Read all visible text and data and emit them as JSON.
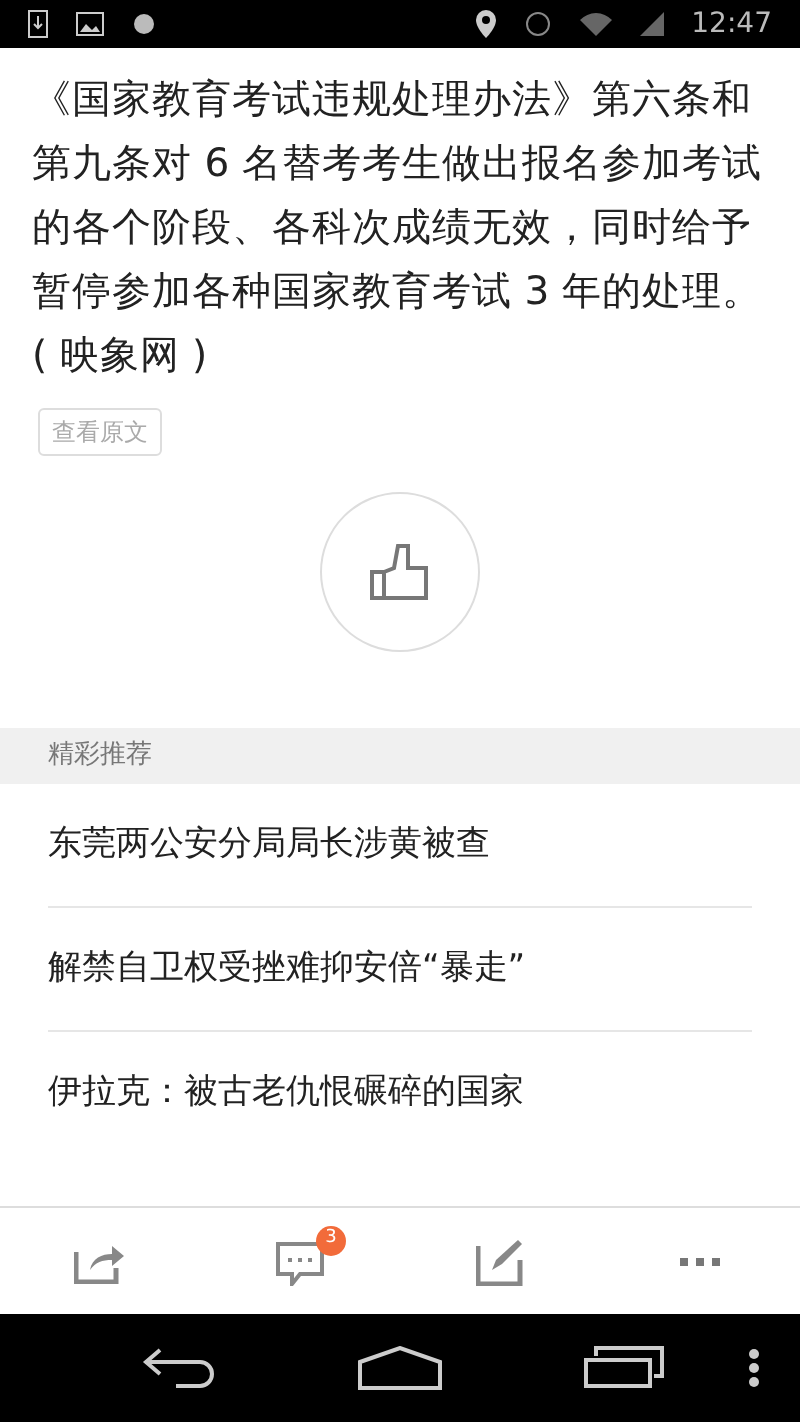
{
  "status_bar": {
    "time": "12:47"
  },
  "article": {
    "paragraph": "《国家教育考试违规处理办法》第六条和第九条对 6 名替考考生做出报名参加考试的各个阶段、各科次成绩无效，同时给予暂停参加各种国家教育考试 3 年的处理。( 映象网 )",
    "source_button": "查看原文"
  },
  "recommend": {
    "title": "精彩推荐",
    "items": [
      "东莞两公安分局局长涉黄被查",
      "解禁自卫权受挫难抑安倍“暴走”",
      "伊拉克：被古老仇恨碾碎的国家"
    ]
  },
  "toolbar": {
    "comment_badge": "3"
  }
}
